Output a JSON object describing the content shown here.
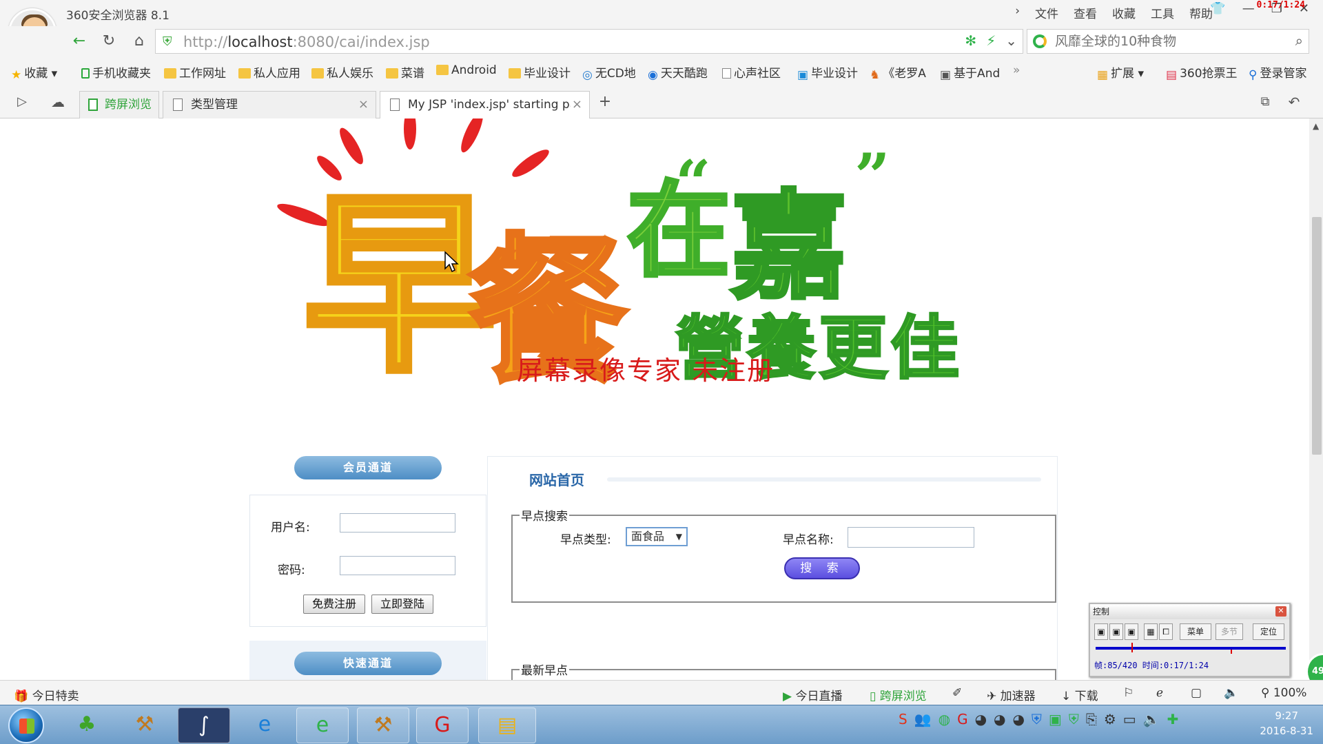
{
  "browser": {
    "app_title": "360安全浏览器 8.1",
    "menu": [
      "文件",
      "查看",
      "收藏",
      "工具",
      "帮助"
    ],
    "recording_time": "0:17/1:24",
    "url_prefix": "http://",
    "url_host": "localhost",
    "url_rest": ":8080/cai/index.jsp",
    "search_placeholder": "风靡全球的10种食物"
  },
  "favorites": {
    "items": [
      {
        "label": "收藏",
        "icon": "star-icon"
      },
      {
        "label": "手机收藏夹",
        "icon": "phone-icon"
      },
      {
        "label": "工作网址",
        "icon": "folder-icon"
      },
      {
        "label": "私人应用",
        "icon": "folder-icon"
      },
      {
        "label": "私人娱乐",
        "icon": "folder-icon"
      },
      {
        "label": "菜谱",
        "icon": "folder-icon"
      },
      {
        "label": "Android",
        "icon": "folder-icon"
      },
      {
        "label": "毕业设计",
        "icon": "folder-icon"
      },
      {
        "label": "无CD地",
        "icon": "cd-icon"
      },
      {
        "label": "天天酷跑",
        "icon": "qq-icon"
      },
      {
        "label": "心声社区",
        "icon": "page-icon"
      },
      {
        "label": "毕业设计",
        "icon": "app-icon"
      },
      {
        "label": "《老罗A",
        "icon": "fox-icon"
      },
      {
        "label": "基于And",
        "icon": "app-icon"
      }
    ],
    "more": "»",
    "right_items": [
      {
        "label": "扩展"
      },
      {
        "label": "360抢票王"
      },
      {
        "label": "登录管家"
      }
    ]
  },
  "tabs": {
    "cross_screen": "跨屏浏览",
    "items": [
      {
        "label": "类型管理"
      },
      {
        "label": "My JSP 'index.jsp' starting pa"
      }
    ],
    "new_tab": "+"
  },
  "page": {
    "banner": {
      "quote_open": "“",
      "word_zao": "早",
      "word_can": "餐",
      "word_zai": "在",
      "word_jia": "嘉",
      "quote_close": "”",
      "slogan": "營養更佳"
    },
    "watermark": "屏幕录像专家 未注册",
    "member_channel": "会员通道",
    "username_label": "用户名:",
    "password_label": "密码:",
    "username_value": "",
    "password_value": "",
    "register_button": "免费注册",
    "login_button": "立即登陆",
    "quick_channel": "快速通道",
    "home_title": "网站首页",
    "search_legend": "早点搜索",
    "type_label": "早点类型:",
    "type_selected": "面食品",
    "name_label": "早点名称:",
    "name_value": "",
    "search_button": "搜 索",
    "latest_legend": "最新早点"
  },
  "recorder_panel": {
    "title": "控制",
    "buttons": [
      "菜单",
      "多节",
      "定位"
    ],
    "info": "帧:85/420 时间:0:17/1:24"
  },
  "badge": "49",
  "statusbar": {
    "left": "今日特卖",
    "live": "今日直播",
    "cross": "跨屏浏览",
    "accel": "加速器",
    "download": "下载",
    "zoom": "100%"
  },
  "taskbar": {
    "time": "9:27",
    "date": "2016-8-31"
  },
  "colors": {
    "link_blue": "#2a67a8",
    "watermark_red": "#d81a1a",
    "accent_green": "#2fb24a"
  }
}
